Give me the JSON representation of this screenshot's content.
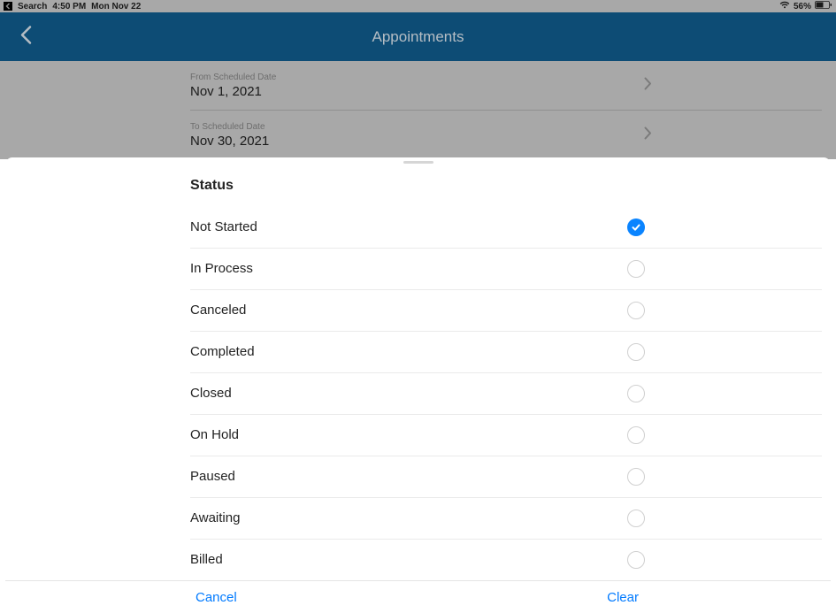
{
  "statusBar": {
    "backApp": "Search",
    "time": "4:50 PM",
    "date": "Mon Nov 22",
    "battery": "56%"
  },
  "nav": {
    "title": "Appointments"
  },
  "filters": {
    "from": {
      "label": "From Scheduled Date",
      "value": "Nov 1, 2021"
    },
    "to": {
      "label": "To Scheduled Date",
      "value": "Nov 30, 2021"
    }
  },
  "sheet": {
    "title": "Status",
    "options": [
      {
        "label": "Not Started",
        "selected": true
      },
      {
        "label": "In Process",
        "selected": false
      },
      {
        "label": "Canceled",
        "selected": false
      },
      {
        "label": "Completed",
        "selected": false
      },
      {
        "label": "Closed",
        "selected": false
      },
      {
        "label": "On Hold",
        "selected": false
      },
      {
        "label": "Paused",
        "selected": false
      },
      {
        "label": "Awaiting",
        "selected": false
      },
      {
        "label": "Billed",
        "selected": false
      }
    ],
    "cancel": "Cancel",
    "clear": "Clear"
  },
  "colors": {
    "accent": "#007aff",
    "navBar": "#0f5a8a"
  }
}
